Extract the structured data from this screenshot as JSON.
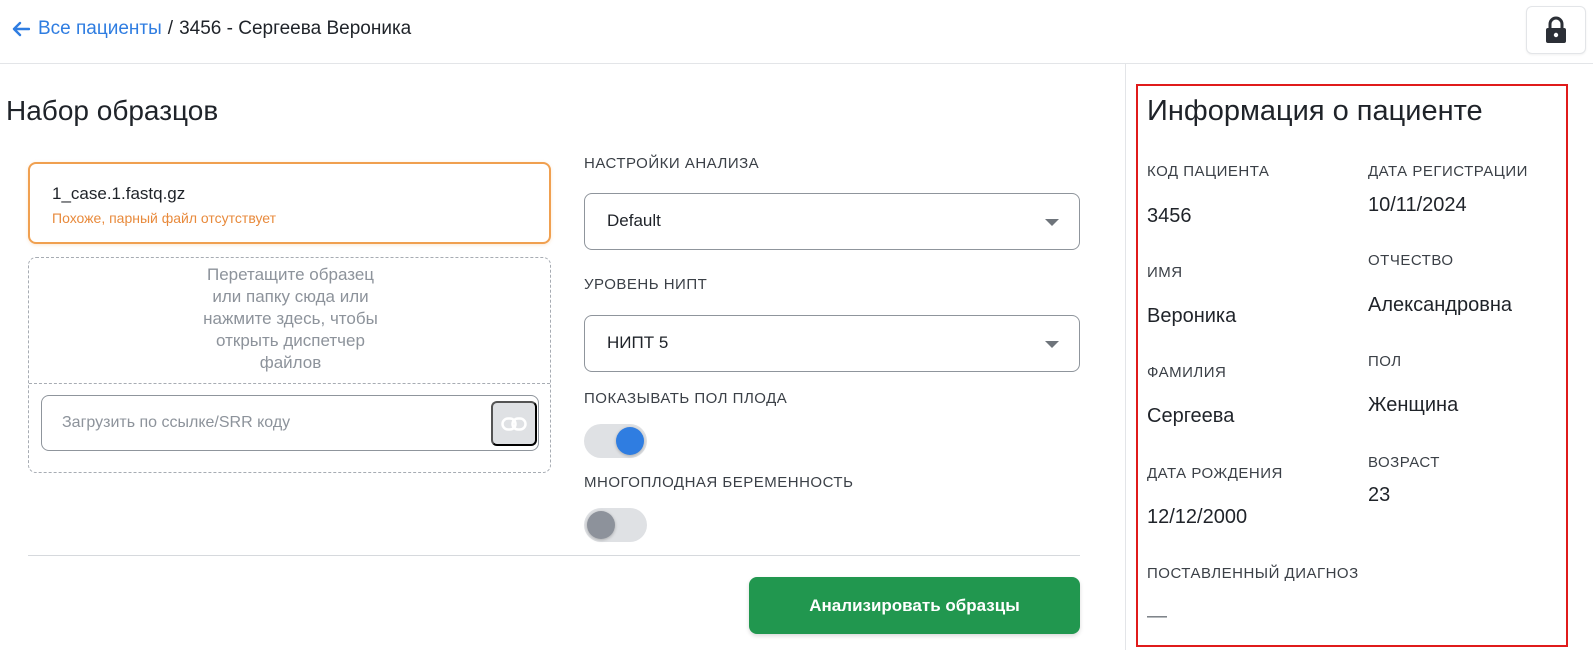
{
  "header": {
    "back_label": "Все пациенты",
    "separator": "/",
    "current": "3456 - Сергеева Вероника",
    "lock_icon": "lock-icon"
  },
  "samples": {
    "title": "Набор образцов",
    "file": {
      "name": "1_case.1.fastq.gz",
      "warning": "Похоже, парный файл отсутствует"
    },
    "dropzone": {
      "lines": [
        "Перетащите образец",
        "или папку сюда или",
        "нажмите здесь, чтобы",
        "открыть диспетчер",
        "файлов"
      ]
    },
    "url_input": {
      "placeholder": "Загрузить по ссылке/SRR коду",
      "value": "",
      "icon": "link-icon"
    }
  },
  "settings": {
    "analysis_label": "Настройки анализа",
    "analysis_value": "Default",
    "nipt_label": "Уровень НИПТ",
    "nipt_value": "НИПТ 5",
    "fetal_sex_label": "Показывать пол плода",
    "fetal_sex_on": true,
    "multiple_label": "Многоплодная беременность",
    "multiple_on": false
  },
  "actions": {
    "analyze_label": "Анализировать образцы",
    "analyze_color": "#21974f"
  },
  "patient": {
    "title": "Информация о пациенте",
    "code_label": "Код пациента",
    "code_value": "3456",
    "reg_date_label": "Дата регистрации",
    "reg_date_value": "10/11/2024",
    "first_name_label": "Имя",
    "first_name_value": "Вероника",
    "patronymic_label": "Отчество",
    "patronymic_value": "Александровна",
    "last_name_label": "Фамилия",
    "last_name_value": "Сергеева",
    "sex_label": "Пол",
    "sex_value": "Женщина",
    "birth_date_label": "Дата рождения",
    "birth_date_value": "12/12/2000",
    "age_label": "Возраст",
    "age_value": "23",
    "diagnosis_label": "Поставленный диагноз",
    "diagnosis_value": "—"
  },
  "colors": {
    "accent": "#2f7de1",
    "warning": "#e88a3c",
    "highlight_border": "#e01b1b"
  }
}
